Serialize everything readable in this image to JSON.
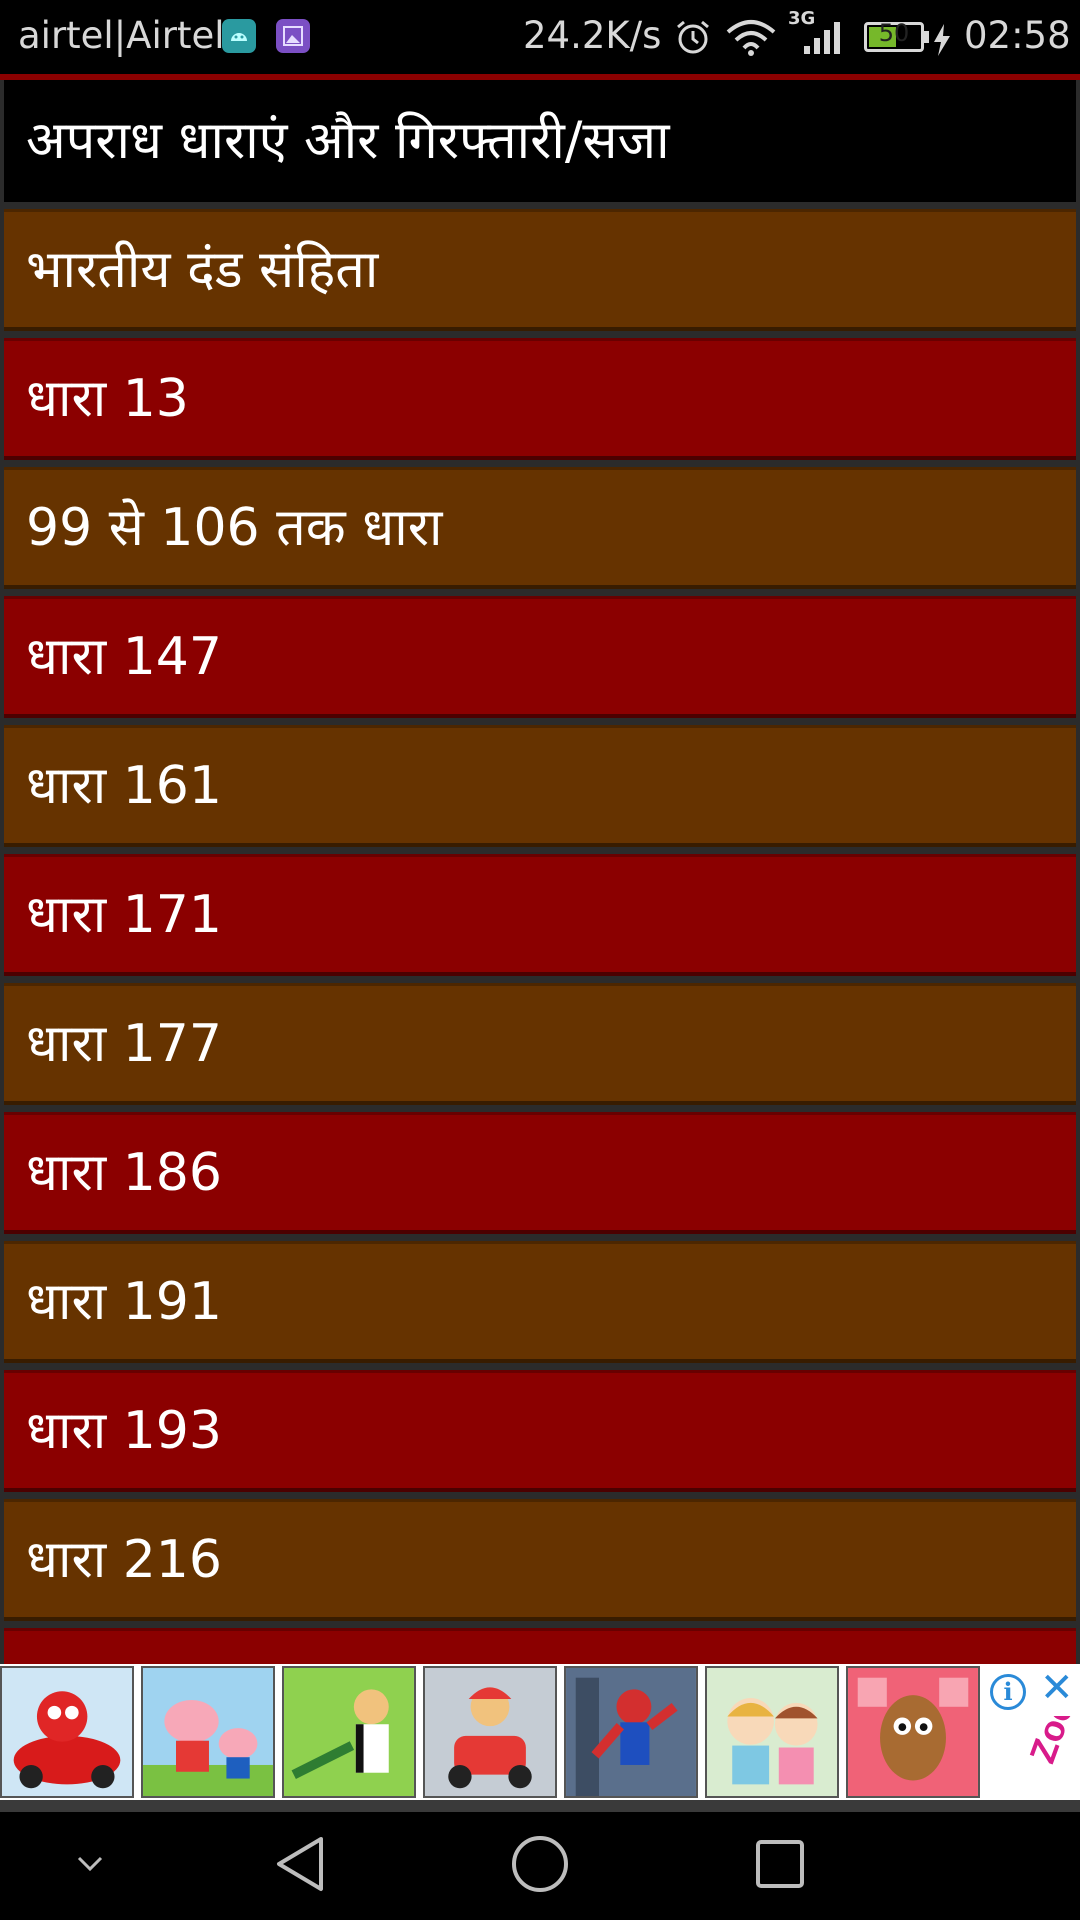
{
  "status_bar": {
    "carrier": "airtel|Airtel",
    "net_speed": "24.2K/s",
    "network_type": "3G",
    "battery_level": "50",
    "time": "02:58",
    "icons": [
      "android-notification-icon",
      "gallery-notification-icon",
      "alarm-icon",
      "wifi-icon",
      "signal-icon",
      "battery-icon",
      "charging-icon"
    ]
  },
  "list": {
    "header": "अपराध धाराएं और गिरफ्तारी/सजा",
    "items": [
      "भारतीय दंड संहिता",
      "धारा 13",
      "99 से 106 तक धारा",
      "धारा 147",
      "धारा 161",
      "धारा 171",
      "धारा 177",
      "धारा 186",
      "धारा 191",
      "धारा 193",
      "धारा 216"
    ]
  },
  "colors": {
    "header_bg": "#000000",
    "row_brown": "#663300",
    "row_red": "#8b0000",
    "text": "#ffffff",
    "ad_accent": "#2a8ad8"
  },
  "ad_banner": {
    "thumbnails": [
      "red-car-game-thumbnail",
      "peppa-pig-thumbnail",
      "ben10-thumbnail",
      "mario-kart-thumbnail",
      "spiderman-thumbnail",
      "baby-hazel-thumbnail",
      "potato-character-thumbnail"
    ],
    "info_label": "i",
    "close_label": "✕",
    "logo_text": "Zoo"
  },
  "nav_bar": {
    "buttons": [
      "hide-keyboard",
      "back",
      "home",
      "recents"
    ]
  }
}
